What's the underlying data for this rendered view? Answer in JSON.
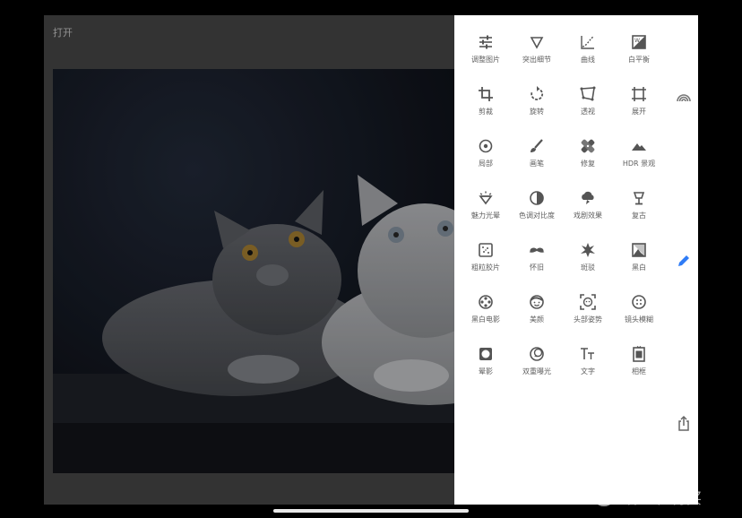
{
  "header": {
    "open_label": "打开"
  },
  "tools": [
    {
      "label": "调整图片",
      "icon": "tune-sliders-icon"
    },
    {
      "label": "突出细节",
      "icon": "details-triangle-icon"
    },
    {
      "label": "曲线",
      "icon": "curves-icon"
    },
    {
      "label": "白平衡",
      "icon": "white-balance-icon"
    },
    {
      "label": "剪裁",
      "icon": "crop-icon"
    },
    {
      "label": "旋转",
      "icon": "rotate-icon"
    },
    {
      "label": "透视",
      "icon": "perspective-icon"
    },
    {
      "label": "展开",
      "icon": "expand-icon"
    },
    {
      "label": "局部",
      "icon": "selective-icon"
    },
    {
      "label": "画笔",
      "icon": "brush-icon"
    },
    {
      "label": "修复",
      "icon": "healing-icon"
    },
    {
      "label": "HDR 景观",
      "icon": "hdr-mountain-icon"
    },
    {
      "label": "魅力光晕",
      "icon": "glamour-glow-icon"
    },
    {
      "label": "色调对比度",
      "icon": "tonal-contrast-icon"
    },
    {
      "label": "戏剧效果",
      "icon": "drama-cloud-icon"
    },
    {
      "label": "复古",
      "icon": "vintage-lamp-icon"
    },
    {
      "label": "粗粒胶片",
      "icon": "grainy-film-icon"
    },
    {
      "label": "怀旧",
      "icon": "retrolux-mustache-icon"
    },
    {
      "label": "斑驳",
      "icon": "grunge-icon"
    },
    {
      "label": "黑白",
      "icon": "black-white-icon"
    },
    {
      "label": "黑白电影",
      "icon": "noir-film-reel-icon"
    },
    {
      "label": "美颜",
      "icon": "face-smile-icon"
    },
    {
      "label": "头部姿势",
      "icon": "head-pose-icon"
    },
    {
      "label": "镜头模糊",
      "icon": "lens-blur-icon"
    },
    {
      "label": "晕影",
      "icon": "vignette-icon"
    },
    {
      "label": "双重曝光",
      "icon": "double-exposure-icon"
    },
    {
      "label": "文字",
      "icon": "text-tt-icon"
    },
    {
      "label": "相框",
      "icon": "frame-icon"
    }
  ],
  "side_buttons": [
    {
      "name": "looks-icon"
    },
    {
      "name": "edit-pencil-icon",
      "color": "#2f7cf6"
    },
    {
      "name": "share-export-icon"
    }
  ],
  "watermark": {
    "text": "什么值得买"
  },
  "colors": {
    "accent": "#2f7cf6",
    "panel_bg": "#ffffff",
    "icon": "#555555"
  }
}
